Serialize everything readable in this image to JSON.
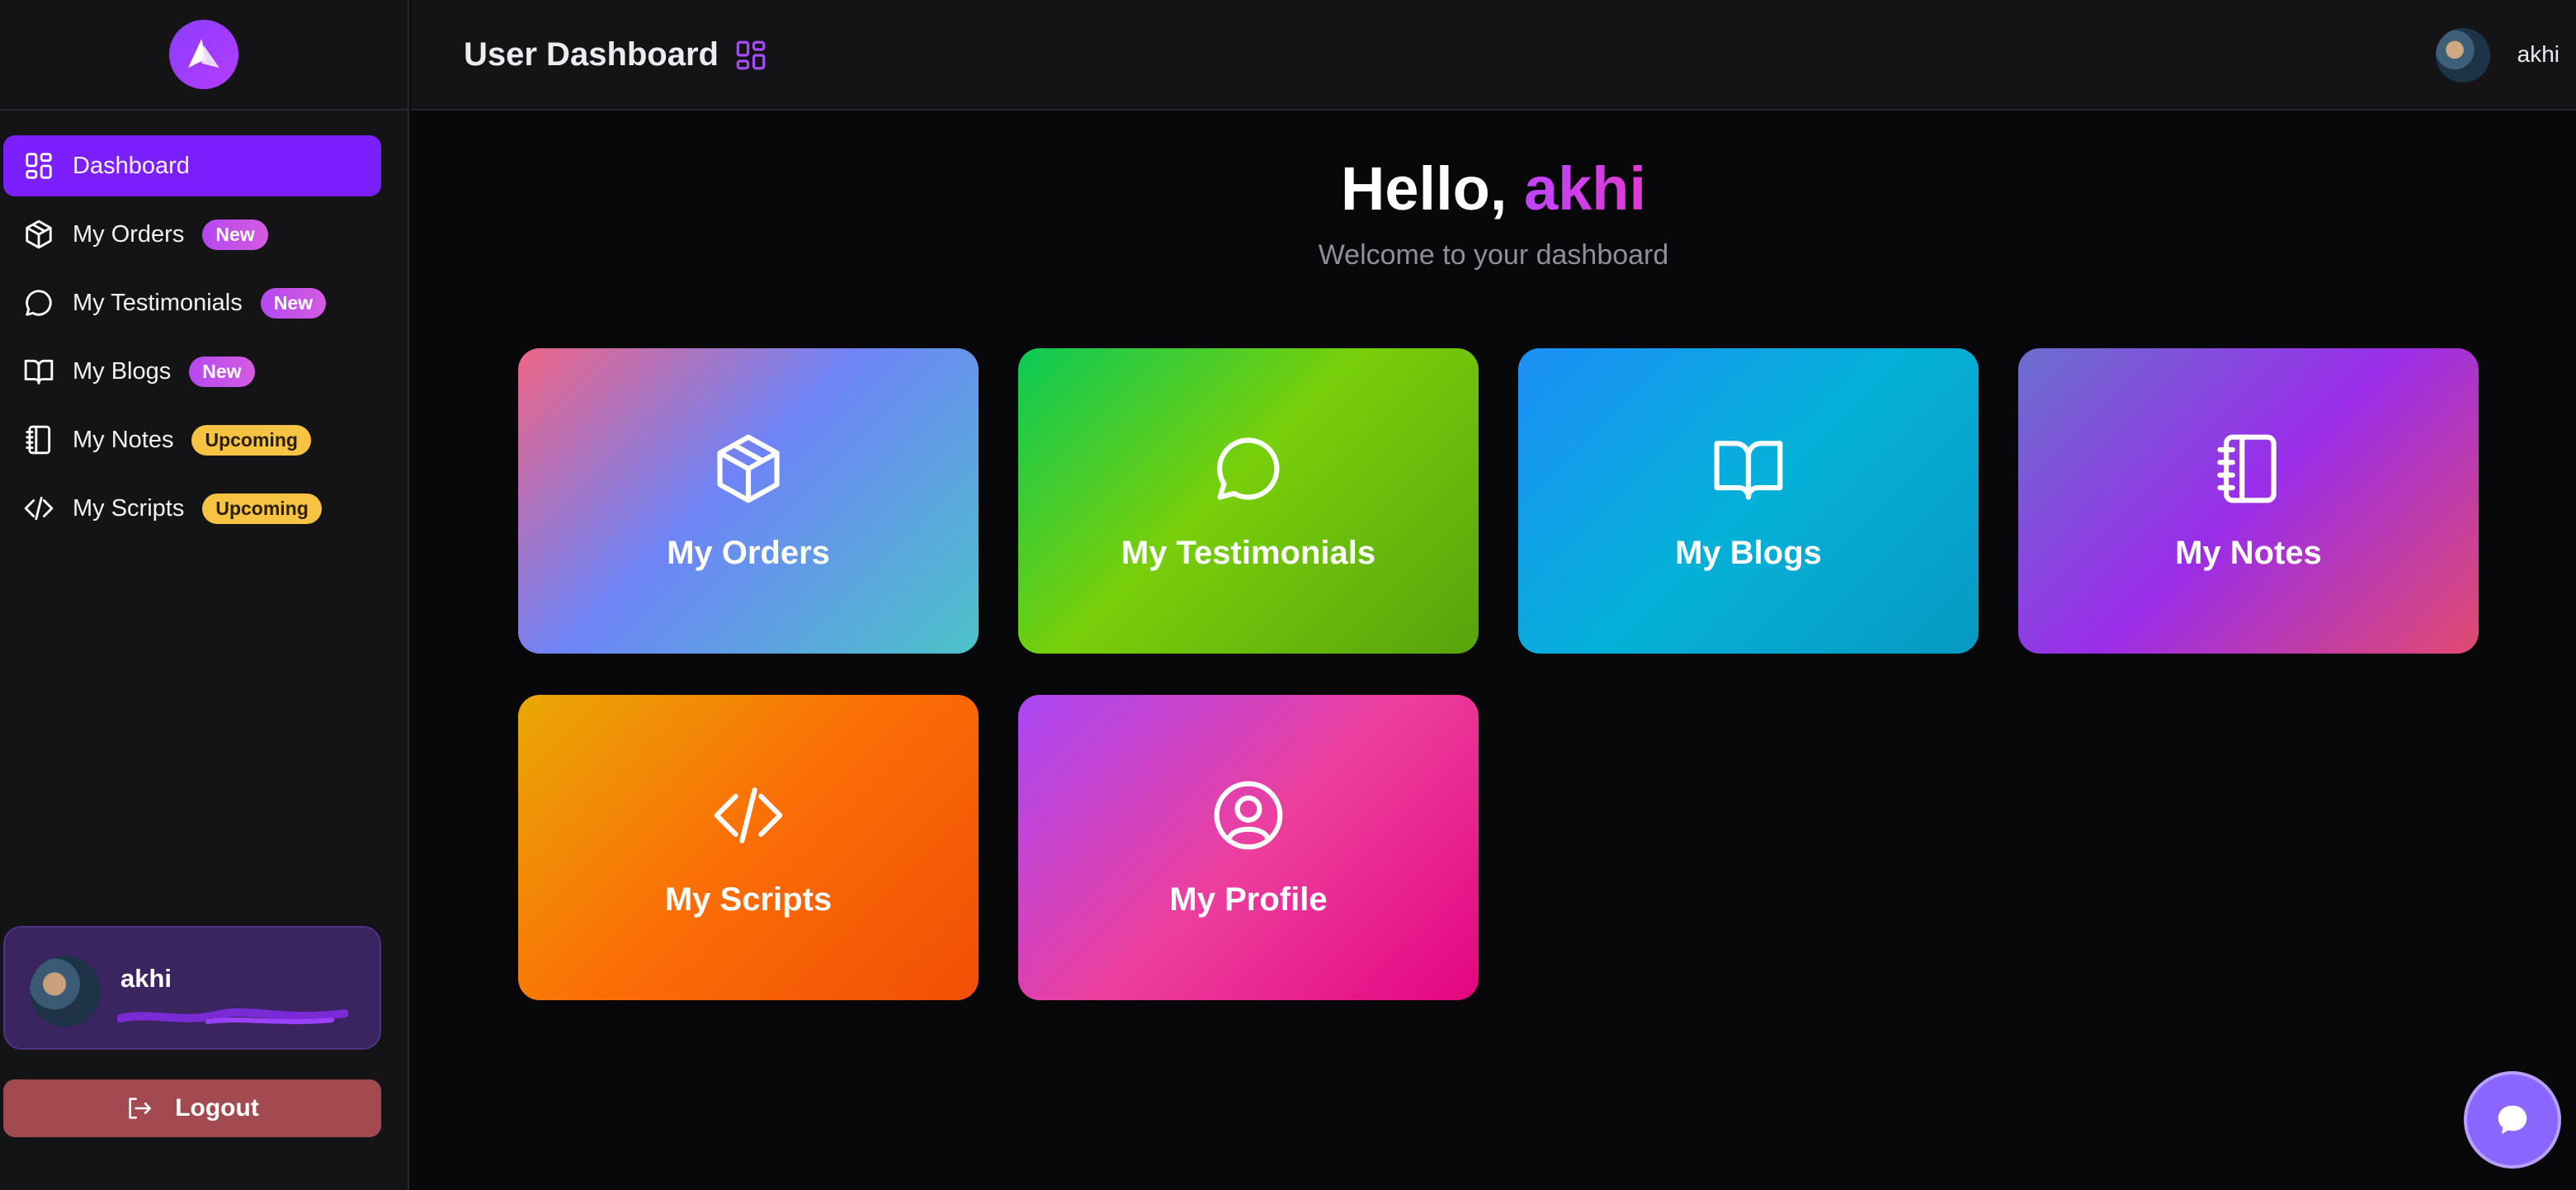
{
  "app": {
    "title": "User Dashboard"
  },
  "sidebar": {
    "items": [
      {
        "label": "Dashboard",
        "badge": "",
        "icon": "dashboard-grid-icon"
      },
      {
        "label": "My Orders",
        "badge": "New",
        "icon": "box-icon"
      },
      {
        "label": "My Testimonials",
        "badge": "New",
        "icon": "chat-bubble-icon"
      },
      {
        "label": "My Blogs",
        "badge": "New",
        "icon": "open-book-icon"
      },
      {
        "label": "My Notes",
        "badge": "Upcoming",
        "icon": "notebook-icon"
      },
      {
        "label": "My Scripts",
        "badge": "Upcoming",
        "icon": "code-icon"
      }
    ],
    "user": {
      "name": "akhi"
    },
    "logout_label": "Logout"
  },
  "topbar": {
    "username": "akhi"
  },
  "main": {
    "greeting": "Hello,",
    "greeting_name": "akhi",
    "welcome": "Welcome to your dashboard",
    "cards": [
      {
        "label": "My Orders",
        "icon": "box-icon"
      },
      {
        "label": "My Testimonials",
        "icon": "chat-bubble-icon"
      },
      {
        "label": "My Blogs",
        "icon": "open-book-icon"
      },
      {
        "label": "My Notes",
        "icon": "notebook-icon"
      },
      {
        "label": "My Scripts",
        "icon": "code-icon"
      },
      {
        "label": "My Profile",
        "icon": "user-circle-icon"
      }
    ]
  },
  "colors": {
    "accent": "#7c1fff",
    "badge_new": "#c34ff0",
    "badge_upcoming": "#f6c343",
    "logout": "#a34a50"
  }
}
